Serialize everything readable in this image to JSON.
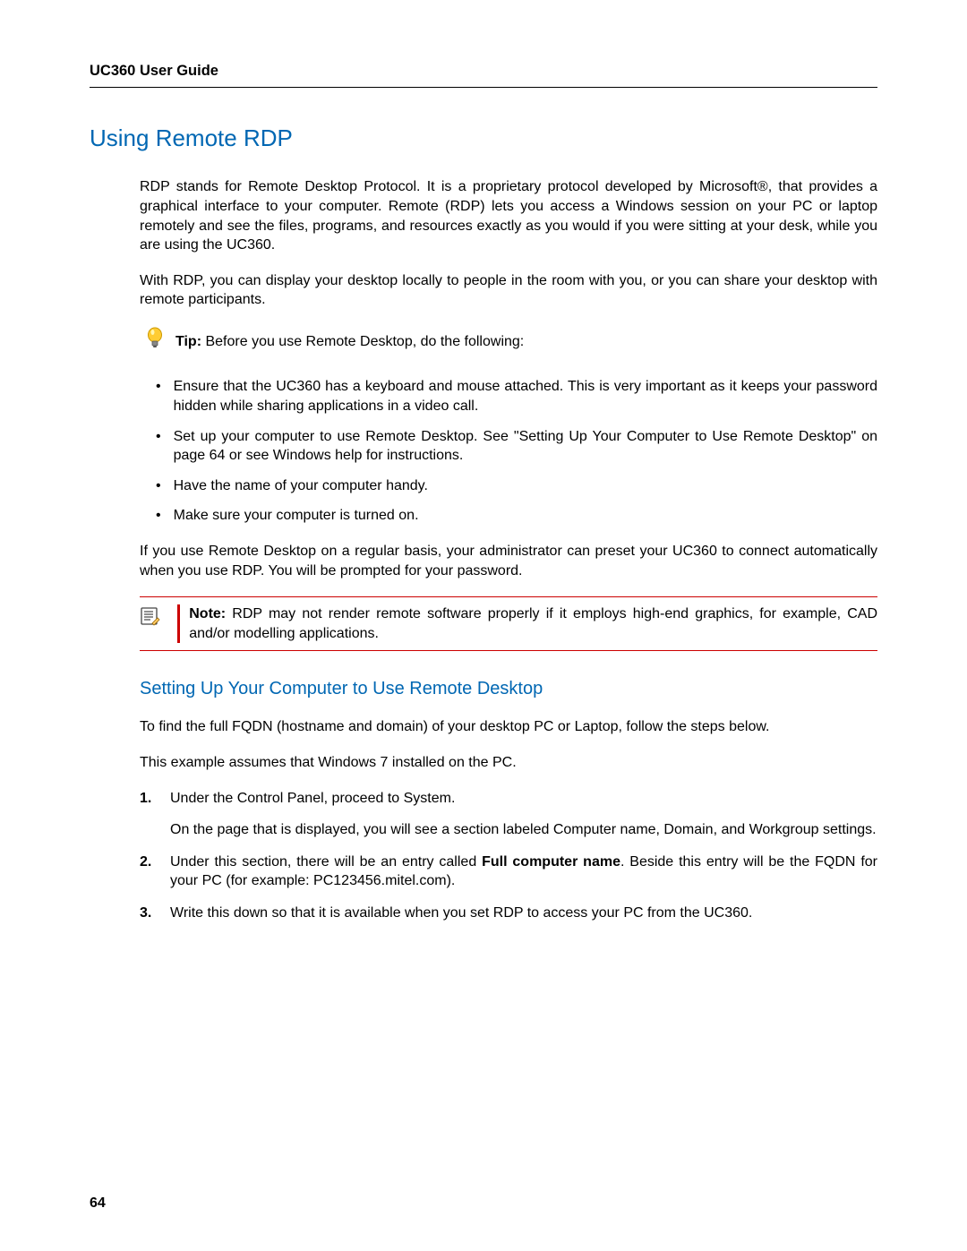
{
  "header": {
    "title": "UC360 User Guide"
  },
  "h1": "Using Remote RDP",
  "intro1": "RDP stands for Remote Desktop Protocol. It is a proprietary protocol developed by Microsoft®, that provides a graphical interface to your computer. Remote (RDP) lets you access a Windows session on your PC or laptop remotely and see the files, programs, and resources exactly as you would if you were sitting at your desk, while you are using the UC360.",
  "intro2": "With RDP, you can display your desktop locally to people in the room with you, or you can share your desktop with remote participants.",
  "tip_label": "Tip:",
  "tip_text": " Before you use Remote Desktop, do the following:",
  "bullets": [
    "Ensure that the UC360 has a keyboard and mouse attached. This is very important as it keeps your password hidden while sharing applications in a video call.",
    "Set up your computer to use Remote Desktop. See \"Setting Up Your Computer to Use Remote Desktop\" on page 64 or see Windows help for instructions.",
    "Have the name of your computer handy.",
    "Make sure your computer is turned on."
  ],
  "after_bullets": "If you use Remote Desktop on a regular basis, your administrator can preset your UC360 to connect automatically when you use RDP. You will be prompted for your password.",
  "note_label": "Note:",
  "note_text": " RDP may not render remote software properly if it employs high-end graphics, for example, CAD and/or modelling applications.",
  "h2": "Setting Up Your Computer to Use Remote Desktop",
  "setup_p1": "To find the full FQDN (hostname and domain) of your desktop PC or Laptop, follow the steps below.",
  "setup_p2": "This example assumes that Windows 7 installed on the PC.",
  "steps": [
    {
      "main": "Under the Control Panel, proceed to System.",
      "sub": "On the page that is displayed, you will see a section labeled Computer name, Domain, and Workgroup settings."
    },
    {
      "pre": "Under this section, there will be an entry called ",
      "bold": "Full computer name",
      "post": ". Beside this entry will be the FQDN for your PC (for example: PC123456.mitel.com)."
    },
    {
      "main": "Write this down so that it is available when you set RDP to access your PC from the UC360."
    }
  ],
  "page_number": "64"
}
